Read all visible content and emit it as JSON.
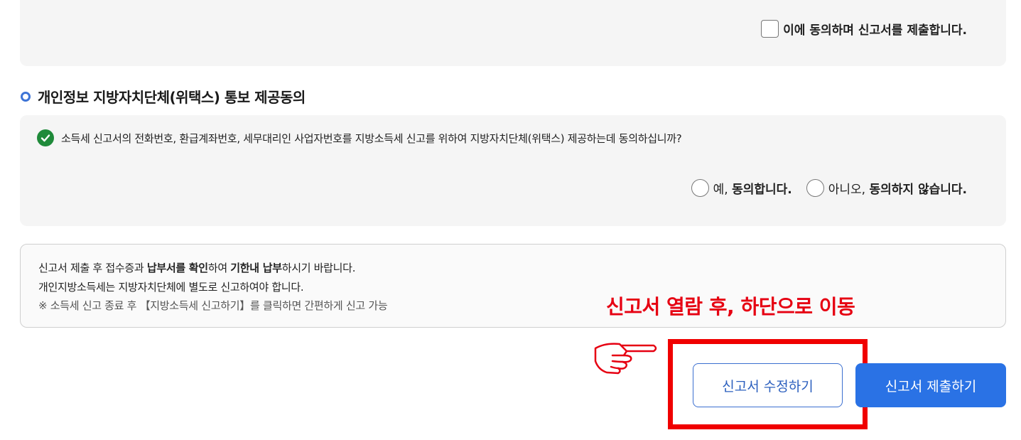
{
  "agreement": {
    "checkbox_label": "이에 동의하며 신고서를 제출합니다."
  },
  "consent_section": {
    "title": "개인정보 지방자치단체(위택스) 통보 제공동의",
    "question": "소득세 신고서의 전화번호, 환급계좌번호, 세무대리인 사업자번호를 지방소득세 신고를 위하여 지방자치단체(위택스) 제공하는데 동의하십니까?",
    "options": [
      {
        "prefix": "예, ",
        "bold": "동의합니다."
      },
      {
        "prefix": "아니오, ",
        "bold": "동의하지 않습니다."
      }
    ]
  },
  "notice": {
    "line1": {
      "p1": "신고서 제출 후 접수증과 ",
      "b1": "납부서를 확인",
      "p2": "하여 ",
      "b2": "기한내 납부",
      "p3": "하시기 바랍니다."
    },
    "line2": "개인지방소득세는 지방자치단체에 별도로 신고하여야 합니다.",
    "line3": "※ 소득세 신고 종료 후 【지방소득세 신고하기】를 클릭하면 간편하게 신고 가능"
  },
  "annotation": {
    "text": "신고서 열람 후, 하단으로 이동",
    "color": "#e60012"
  },
  "buttons": {
    "edit": "신고서 수정하기",
    "submit": "신고서 제출하기"
  },
  "colors": {
    "accent": "#2a72e5",
    "check_green": "#1f8a3a",
    "highlight_frame": "#f00000"
  }
}
